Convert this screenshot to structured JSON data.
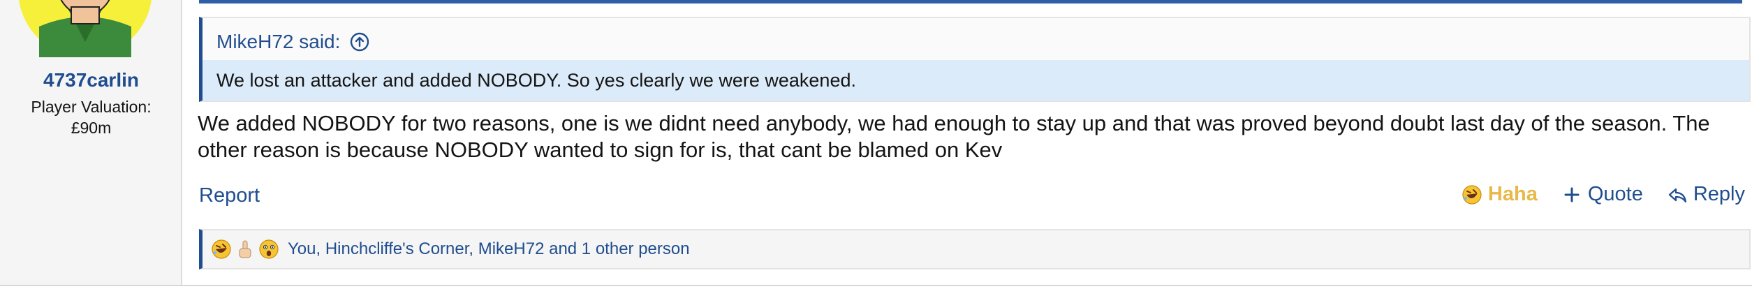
{
  "user": {
    "username": "4737carlin",
    "meta_line1": "Player Valuation:",
    "meta_line2": "£90m"
  },
  "quote": {
    "author": "MikeH72 said:",
    "text": "We lost an attacker and added NOBODY. So yes clearly we were weakened."
  },
  "message": {
    "text": "We added NOBODY for two reasons, one is we didnt need anybody, we had enough to stay up and that was proved beyond doubt last day of the season. The other reason is because NOBODY wanted to sign for is, that cant be blamed on Kev"
  },
  "actions": {
    "report": "Report",
    "haha": "Haha",
    "quote": "Quote",
    "reply": "Reply"
  },
  "reactions": {
    "text": "You, Hinchcliffe's Corner, MikeH72 and 1 other person",
    "icons": [
      "rofl-icon",
      "middle-finger-icon",
      "astonished-icon"
    ]
  },
  "colors": {
    "link": "#1f4d8f",
    "accent_bar": "#2f5fa8",
    "quote_bg": "#dcebf9",
    "haha": "#e8b94a"
  }
}
